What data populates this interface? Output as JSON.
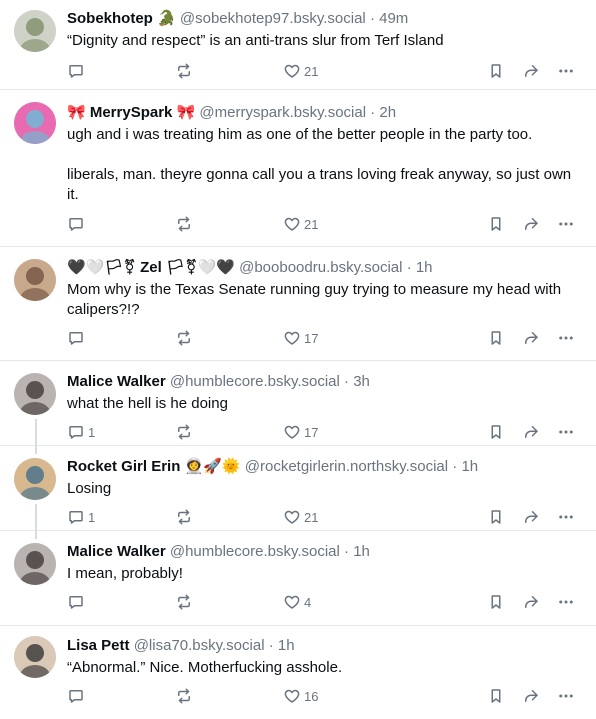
{
  "posts": [
    {
      "name": "Sobekhotep",
      "name_suffix": "🐊",
      "handle": "@sobekhotep97.bsky.social",
      "time": "49m",
      "lines": [
        "“Dignity and respect” is an anti-trans slur from Terf Island"
      ],
      "replies": "",
      "likes": "21",
      "avatar_colors": [
        "#cfd3c7",
        "#7b8a63"
      ]
    },
    {
      "name": "🎀 MerrySpark 🎀",
      "name_suffix": "",
      "handle": "@merryspark.bsky.social",
      "time": "2h",
      "lines": [
        "ugh and i was treating him as one of the better people in the party too.",
        "",
        "liberals, man. theyre gonna call you a trans loving freak anyway, so just own it."
      ],
      "replies": "",
      "likes": "21",
      "avatar_colors": [
        "#e86bb2",
        "#5ec3d9"
      ]
    },
    {
      "name": "🖤🤍🏳⚧ Zel 🏳⚧🤍🖤",
      "name_suffix": "",
      "handle": "@booboodru.bsky.social",
      "time": "1h",
      "lines": [
        "Mom why is the Texas Senate running guy trying to measure my head with calipers?!?"
      ],
      "replies": "",
      "likes": "17",
      "avatar_colors": [
        "#c9a98c",
        "#6b4f3d"
      ]
    },
    {
      "name": "Malice Walker",
      "name_suffix": "",
      "handle": "@humblecore.bsky.social",
      "time": "3h",
      "lines": [
        "what the hell is he doing"
      ],
      "replies": "1",
      "likes": "17",
      "avatar_colors": [
        "#b9b4b1",
        "#3a3230"
      ]
    },
    {
      "name": "Rocket Girl Erin",
      "name_suffix": "👩‍🚀🚀🌞",
      "handle": "@rocketgirlerin.northsky.social",
      "time": "1h",
      "lines": [
        "Losing"
      ],
      "replies": "1",
      "likes": "21",
      "avatar_colors": [
        "#d8b98f",
        "#3b6a8a"
      ]
    },
    {
      "name": "Malice Walker",
      "name_suffix": "",
      "handle": "@humblecore.bsky.social",
      "time": "1h",
      "lines": [
        "I mean, probably!"
      ],
      "replies": "",
      "likes": "4",
      "avatar_colors": [
        "#b9b4b1",
        "#3a3230"
      ]
    },
    {
      "name": "Lisa Pett",
      "name_suffix": "",
      "handle": "@lisa70.bsky.social",
      "time": "1h",
      "lines": [
        "“Abnormal.” Nice. Motherfucking asshole."
      ],
      "replies": "",
      "likes": "16",
      "avatar_colors": [
        "#d9c9b6",
        "#2b2b2b"
      ]
    }
  ],
  "separator": "·",
  "colors": {
    "meta": "#6a7480",
    "border": "#e5e8eb",
    "thread_line": "#d7dce1"
  },
  "icons": [
    "reply-icon",
    "repost-icon",
    "like-icon",
    "bookmark-icon",
    "share-icon",
    "more-icon"
  ]
}
